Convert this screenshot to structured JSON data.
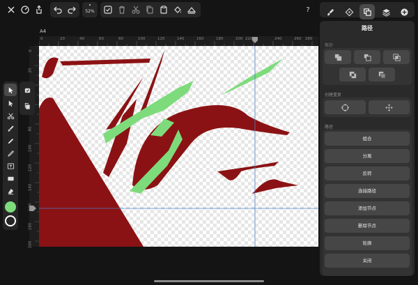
{
  "toolbar": {
    "zoom_label": "52%",
    "help_label": "?"
  },
  "document": {
    "name": "A4"
  },
  "rulers": {
    "horizontal_ticks": [
      "0",
      "20",
      "40",
      "60",
      "80",
      "100",
      "120",
      "140",
      "160",
      "180",
      "200",
      "220",
      "240",
      "260",
      "280"
    ],
    "vertical_ticks": [
      "0",
      "20",
      "40",
      "60",
      "80",
      "100",
      "120",
      "140",
      "160",
      "180",
      "200"
    ]
  },
  "panel": {
    "title": "路径",
    "boolean_label": "布尔",
    "create_label": "创建重复",
    "path_label": "路径",
    "actions": [
      "组合",
      "分离",
      "反转",
      "连接路径",
      "添加节点",
      "删除节点",
      "轮廓",
      "关闭"
    ]
  },
  "colors": {
    "fill": "#7edb7c",
    "stroke": "#ffffff",
    "shape_dark_red": "#8b1214",
    "shape_green": "#7edb7c",
    "guide": "#4a7fc8"
  }
}
